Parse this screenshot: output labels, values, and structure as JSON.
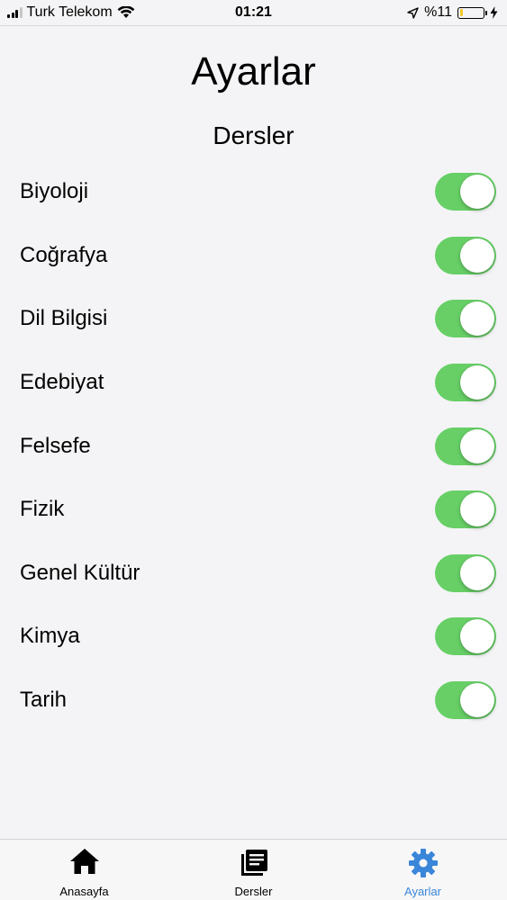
{
  "status_bar": {
    "carrier": "Turk Telekom",
    "time": "01:21",
    "battery_text": "%11",
    "battery_level": 0.11,
    "icons": [
      "signal-icon",
      "wifi-icon",
      "location-arrow-icon",
      "battery-icon",
      "charging-bolt-icon"
    ]
  },
  "header": {
    "title": "Ayarlar",
    "section_title": "Dersler"
  },
  "subjects": [
    {
      "label": "Biyoloji",
      "enabled": true
    },
    {
      "label": "Coğrafya",
      "enabled": true
    },
    {
      "label": "Dil Bilgisi",
      "enabled": true
    },
    {
      "label": "Edebiyat",
      "enabled": true
    },
    {
      "label": "Felsefe",
      "enabled": true
    },
    {
      "label": "Fizik",
      "enabled": true
    },
    {
      "label": "Genel Kültür",
      "enabled": true
    },
    {
      "label": "Kimya",
      "enabled": true
    },
    {
      "label": "Tarih",
      "enabled": true
    }
  ],
  "tab_bar": {
    "tabs": [
      {
        "label": "Anasayfa",
        "icon": "home-icon",
        "active": false
      },
      {
        "label": "Dersler",
        "icon": "book-icon",
        "active": false
      },
      {
        "label": "Ayarlar",
        "icon": "gear-icon",
        "active": true
      }
    ]
  },
  "colors": {
    "toggle_on": "#67cf66",
    "tab_active": "#3a86d9",
    "tab_inactive": "#000000",
    "background": "#f4f4f6"
  }
}
